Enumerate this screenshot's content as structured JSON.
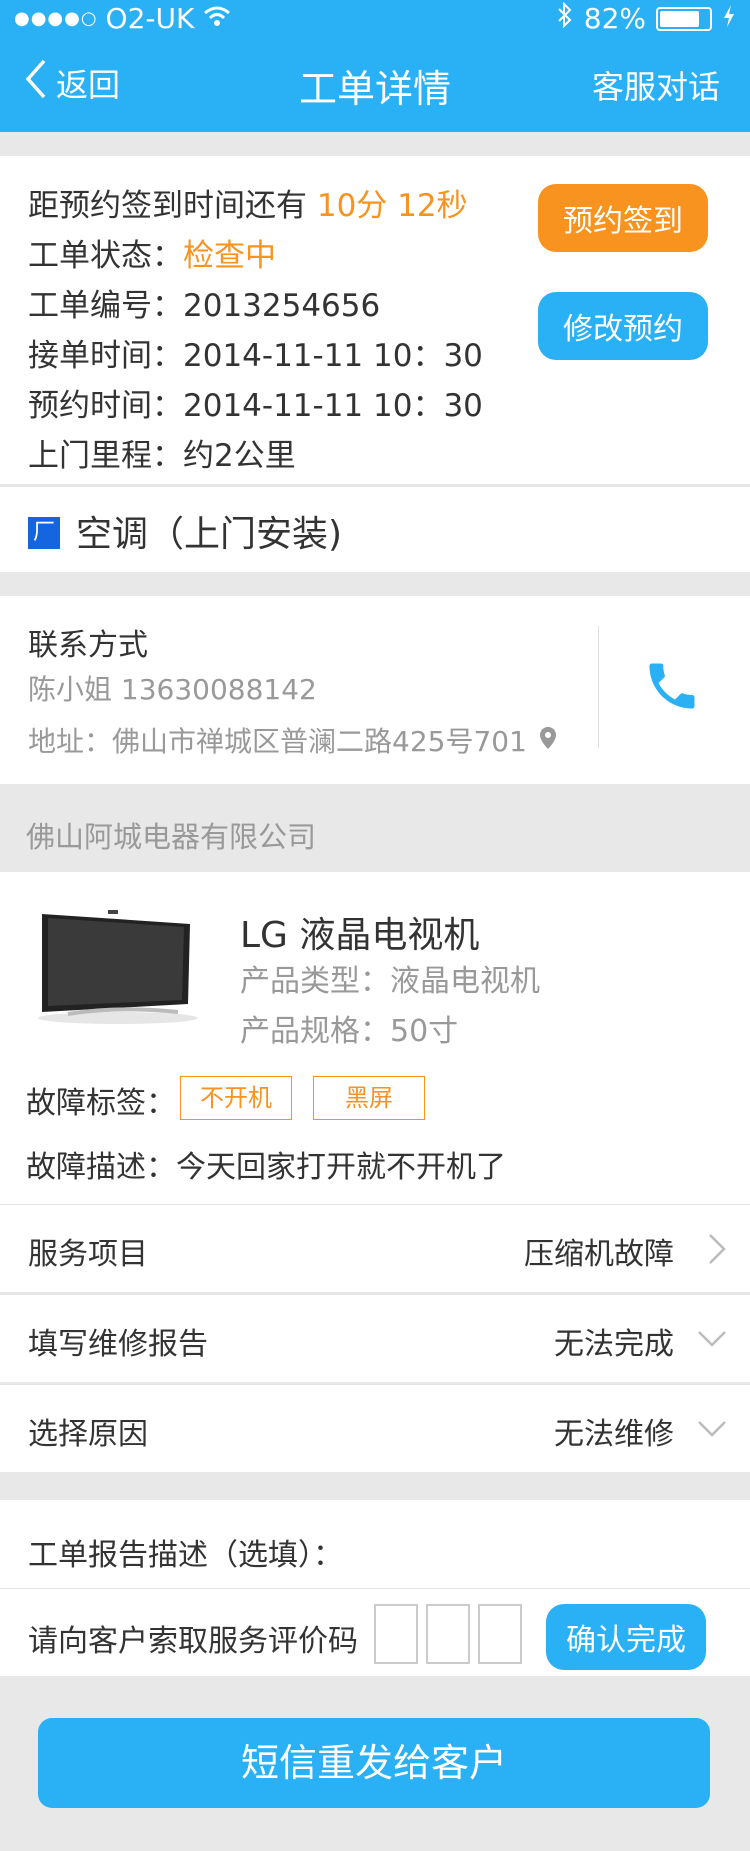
{
  "status_bar": {
    "carrier": "O2-UK",
    "signal_dots": "●●●●○",
    "battery": "82%",
    "battery_level": 0.82
  },
  "nav": {
    "back_label": "返回",
    "title": "工单详情",
    "right_label": "客服对话"
  },
  "order": {
    "countdown_label": "距预约签到时间还有",
    "countdown_value": "10分 12秒",
    "status_label": "工单状态：",
    "status_value": "检查中",
    "number_line": "工单编号：2013254656",
    "accept_time_line": "接单时间：2014-11-11  10：30",
    "appoint_time_line": "预约时间：2014-11-11  10：30",
    "distance_line": "上门里程：约2公里",
    "checkin_button": "预约签到",
    "modify_button": "修改预约"
  },
  "category": {
    "icon_char": "厂",
    "text": "空调（上门安装)"
  },
  "contact": {
    "title": "联系方式",
    "name_phone": "陈小姐   13630088142",
    "address": "地址：佛山市禅城区普澜二路425号701"
  },
  "company": "佛山阿城电器有限公司",
  "product": {
    "name": "LG   液晶电视机",
    "type_line": "产品类型：液晶电视机",
    "spec_line": "产品规格：50寸",
    "tags_label": "故障标签：",
    "tags": [
      "不开机",
      "黑屏"
    ],
    "description_line": "故障描述：今天回家打开就不开机了"
  },
  "rows": [
    {
      "label": "服务项目",
      "value": "压缩机故障"
    },
    {
      "label": "填写维修报告",
      "value": "无法完成"
    },
    {
      "label": "选择原因",
      "value": "无法维修"
    }
  ],
  "report": {
    "desc_label": "工单报告描述（选填）：",
    "code_label": "请向客户索取服务评价码",
    "confirm_button": "确认完成"
  },
  "resend_button": "短信重发给客户",
  "colors": {
    "primary": "#2ab0f5",
    "accent": "#f7931e"
  }
}
